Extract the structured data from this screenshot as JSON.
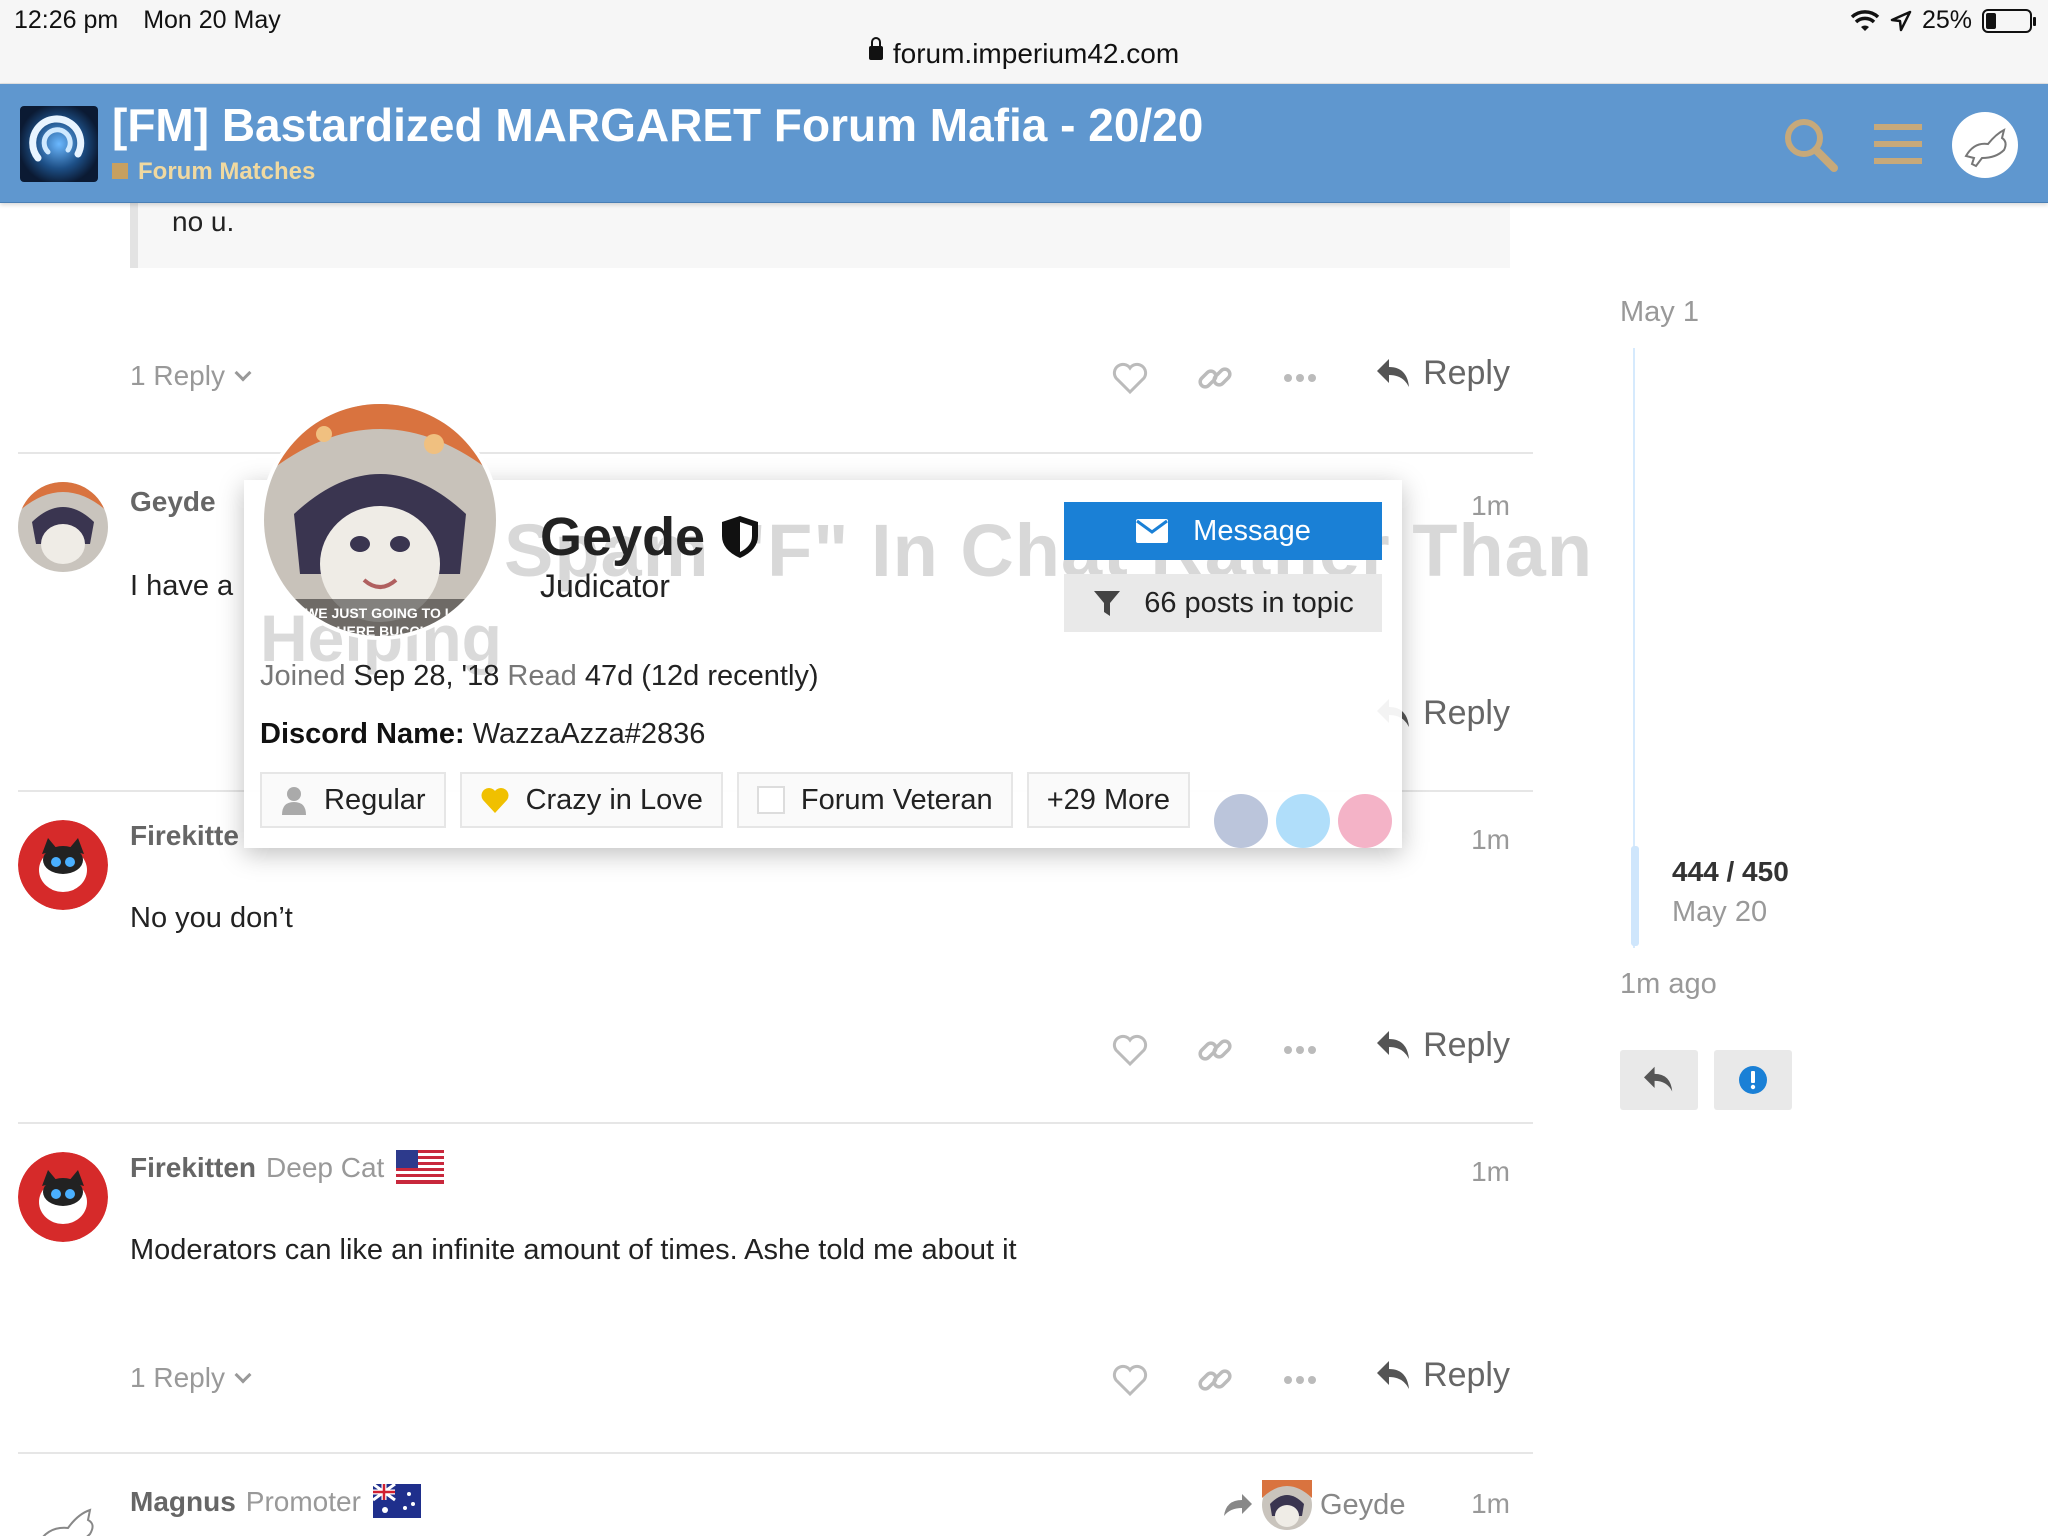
{
  "statusbar": {
    "time": "12:26 pm",
    "date": "Mon 20 May",
    "battery": "25%",
    "url": "forum.imperium42.com"
  },
  "header": {
    "title": "[FM] Bastardized MARGARET Forum Mafia - 20/20",
    "category": "Forum Matches",
    "icons": [
      "logo-icon",
      "search-icon",
      "hamburger-icon",
      "user-avatar"
    ]
  },
  "quote": {
    "text": "no u."
  },
  "actions": {
    "replies_1": "1 Reply",
    "reply_label": "Reply"
  },
  "posts": [
    {
      "username": "Geyde",
      "time": "1m",
      "body": "I have a"
    },
    {
      "username": "Firekitte",
      "time": "1m",
      "body": "No you don’t"
    },
    {
      "username": "Firekitten",
      "usertitle": "Deep Cat",
      "time": "1m",
      "body": "Moderators can like an infinite amount of times. Ashe told me about it"
    },
    {
      "username": "Magnus",
      "usertitle": "Promoter",
      "reply_to": "Geyde",
      "time": "1m"
    }
  ],
  "timeline": {
    "start": "May 1",
    "position": "444 / 450",
    "current_date": "May 20",
    "end": "1m ago"
  },
  "usercard": {
    "name": "Geyde",
    "title": "Judicator",
    "message_label": "Message",
    "filter_label": "66 posts in topic",
    "joined_label": "Joined",
    "joined": "Sep 28, '18",
    "read_label": "Read",
    "read": "47d (12d recently)",
    "discord_label": "Discord Name:",
    "discord": "WazzaAzza#2836",
    "badges": [
      "Regular",
      "Crazy in Love",
      "Forum Veteran",
      "+29 More"
    ],
    "avatar_caption": "WE JUST GOING TO L... HERE BUCCIA",
    "bg_text": "Spam \"F\" In Chat Rather Than",
    "bg_text2": "Helping"
  },
  "colors": {
    "header_bg": "#5f97cf",
    "message_btn": "#1a80d6",
    "timeline": "#d6eafd"
  }
}
